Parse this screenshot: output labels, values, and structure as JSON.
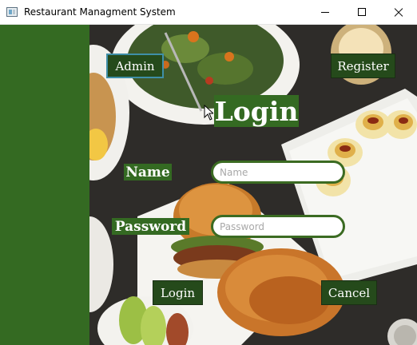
{
  "window": {
    "title": "Restaurant Managment System",
    "controls": {
      "minimize": "minimize-icon",
      "maximize": "maximize-icon",
      "close": "close-icon"
    }
  },
  "colors": {
    "side_panel": "#346a22",
    "button_bg": "#254a1b",
    "field_border": "#3b6b22",
    "admin_focus_border": "#3f8fa8"
  },
  "header": {
    "admin_label": "Admin",
    "register_label": "Register",
    "title": "Login"
  },
  "form": {
    "name_label": "Name",
    "name_placeholder": "Name",
    "name_value": "",
    "password_label": "Password",
    "password_placeholder": "Password",
    "password_value": ""
  },
  "actions": {
    "login_label": "Login",
    "cancel_label": "Cancel"
  }
}
